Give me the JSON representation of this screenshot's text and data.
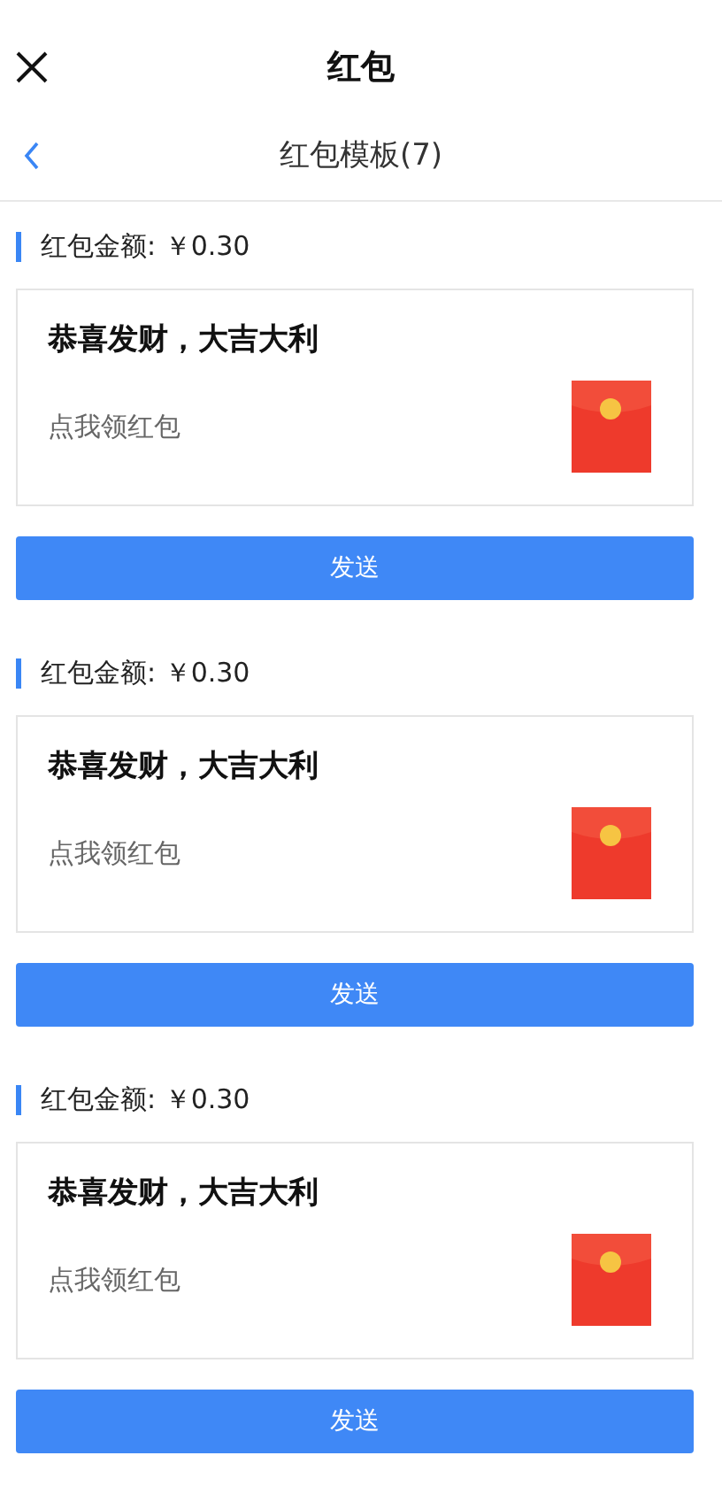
{
  "header": {
    "title": "红包"
  },
  "subheader": {
    "title": "红包模板(7)"
  },
  "templates": [
    {
      "amount_label": "红包金额: ￥0.30",
      "greeting": "恭喜发财，大吉大利",
      "hint": "点我领红包",
      "button": "发送"
    },
    {
      "amount_label": "红包金额: ￥0.30",
      "greeting": "恭喜发财，大吉大利",
      "hint": "点我领红包",
      "button": "发送"
    },
    {
      "amount_label": "红包金额: ￥0.30",
      "greeting": "恭喜发财，大吉大利",
      "hint": "点我领红包",
      "button": "发送"
    }
  ]
}
